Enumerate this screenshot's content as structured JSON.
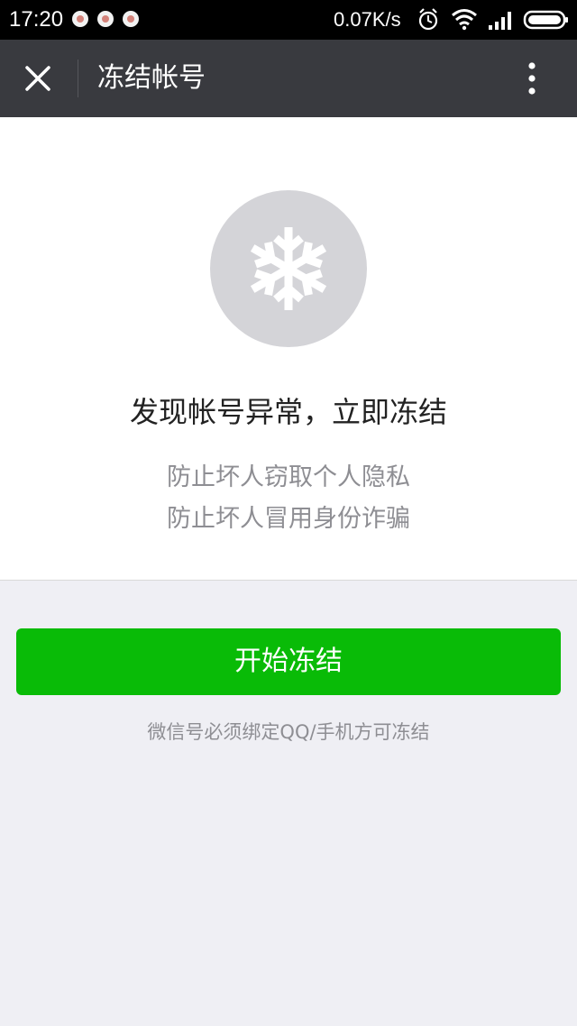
{
  "status_bar": {
    "time": "17:20",
    "network_speed": "0.07K/s",
    "icons": [
      "notification-icon",
      "notification-icon",
      "notification-icon",
      "alarm-icon",
      "wifi-icon",
      "signal-icon",
      "battery-icon"
    ]
  },
  "nav": {
    "title": "冻结帐号",
    "close_icon": "close-icon",
    "more_icon": "more-vertical-icon"
  },
  "main": {
    "icon": "snowflake-icon",
    "headline": "发现帐号异常，立即冻结",
    "line1": "防止坏人窃取个人隐私",
    "line2": "防止坏人冒用身份诈骗",
    "button_label": "开始冻结",
    "hint": "微信号必须绑定QQ/手机方可冻结"
  },
  "colors": {
    "nav_bg": "#393a3f",
    "primary": "#09bb07",
    "page_bg": "#efeff4",
    "icon_circle": "#d4d4d8"
  }
}
